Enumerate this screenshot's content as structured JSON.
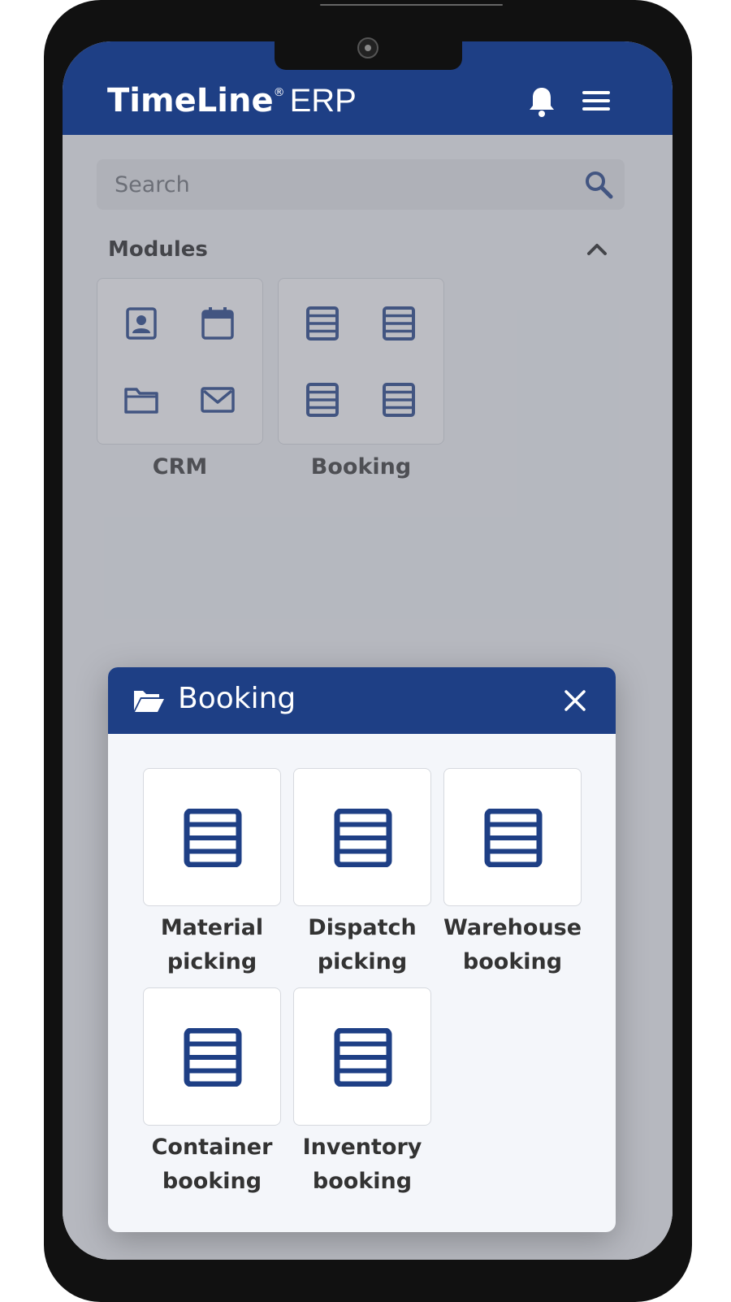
{
  "header": {
    "logo_main": "TimeLine",
    "logo_registered": "®",
    "logo_sub": "ERP",
    "icons": [
      "bell-icon",
      "hamburger-menu-icon"
    ]
  },
  "search": {
    "placeholder": "Search",
    "icon": "search-icon"
  },
  "modules": {
    "title": "Modules",
    "toggle_icon": "chevron-up-icon",
    "items": [
      {
        "label": "CRM",
        "icons": [
          "contact-card-icon",
          "calendar-icon",
          "folder-icon",
          "mail-icon"
        ]
      },
      {
        "label": "Booking",
        "icons": [
          "list-icon",
          "list-icon",
          "list-icon",
          "list-icon"
        ]
      }
    ]
  },
  "dialog": {
    "title": "Booking",
    "title_icon": "folder-open-icon",
    "close_icon": "close-icon",
    "items": [
      {
        "line1": "Material",
        "line2": "picking",
        "icon": "list-icon"
      },
      {
        "line1": "Dispatch",
        "line2": "picking",
        "icon": "list-icon"
      },
      {
        "line1": "Warehouse",
        "line2": "booking",
        "icon": "list-icon"
      },
      {
        "line1": "Container",
        "line2": "booking",
        "icon": "list-icon"
      },
      {
        "line1": "Inventory",
        "line2": "booking",
        "icon": "list-icon"
      }
    ]
  },
  "colors": {
    "brand": "#1e3f85",
    "background": "#f0f2f6",
    "tile": "#ffffff"
  }
}
